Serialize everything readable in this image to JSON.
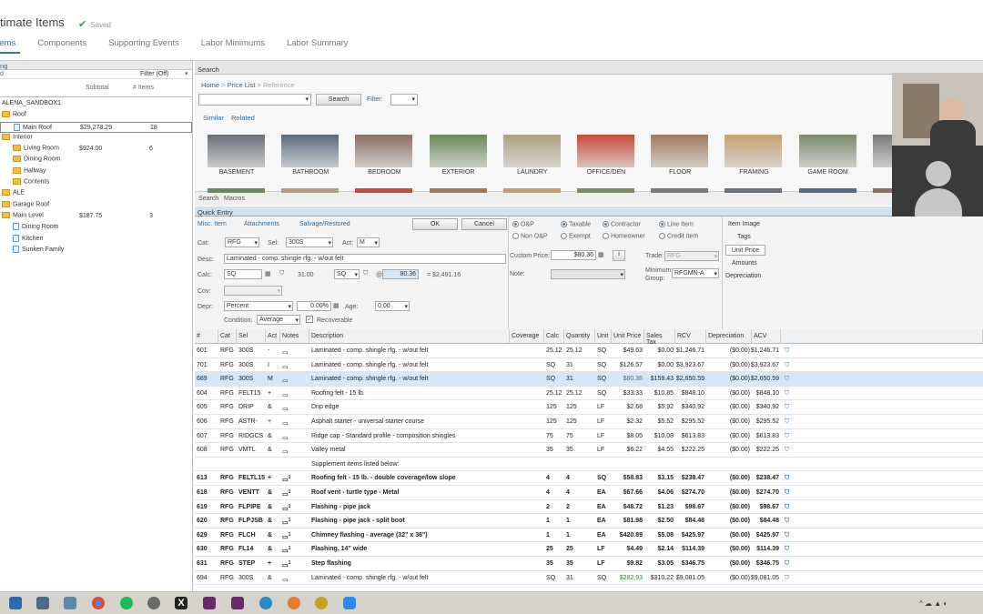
{
  "header": {
    "title": "timate Items",
    "saved": "Saved"
  },
  "tabs": [
    "Items",
    "Components",
    "Supporting Events",
    "Labor Minimums",
    "Labor Summary"
  ],
  "left": {
    "col_label": "ng",
    "filter": "Filter (Off)",
    "sub_label": "d",
    "subtotal_h": "Subtotal",
    "items_h": "# Items",
    "tree": [
      {
        "label": "ALENA_SANDBOX1",
        "type": "none",
        "indent": 0,
        "subtotal": "",
        "items": ""
      },
      {
        "label": "Roof",
        "type": "folder",
        "indent": 0,
        "subtotal": "",
        "items": ""
      },
      {
        "label": "Main Roof",
        "type": "page",
        "indent": 1,
        "subtotal": "$29,278.29",
        "items": "18"
      },
      {
        "label": "Interior",
        "type": "folder",
        "indent": 0,
        "subtotal": "",
        "items": ""
      },
      {
        "label": "Living Room",
        "type": "folder",
        "indent": 1,
        "subtotal": "$924.00",
        "items": "6"
      },
      {
        "label": "Dining Room",
        "type": "folder",
        "indent": 1,
        "subtotal": "",
        "items": ""
      },
      {
        "label": "Hallway",
        "type": "folder",
        "indent": 1,
        "subtotal": "",
        "items": ""
      },
      {
        "label": "Contents",
        "type": "folder",
        "indent": 1,
        "subtotal": "",
        "items": ""
      },
      {
        "label": "ALE",
        "type": "folder",
        "indent": 0,
        "subtotal": "",
        "items": ""
      },
      {
        "label": "Garage Roof",
        "type": "folder",
        "indent": 0,
        "subtotal": "",
        "items": ""
      },
      {
        "label": "Main Level",
        "type": "folder",
        "indent": 0,
        "subtotal": "$187.75",
        "items": "3"
      },
      {
        "label": "Dining Room",
        "type": "page",
        "indent": 1,
        "subtotal": "",
        "items": ""
      },
      {
        "label": "Kitchen",
        "type": "page",
        "indent": 1,
        "subtotal": "",
        "items": ""
      },
      {
        "label": "Sunken Family",
        "type": "page",
        "indent": 1,
        "subtotal": "",
        "items": ""
      }
    ]
  },
  "search": {
    "title": "Search",
    "crumbs": [
      "Home",
      ">",
      "Price List",
      ">",
      "Reference"
    ],
    "search_btn": "Search",
    "filter": "Filter:",
    "similar": "Similar",
    "related": "Related",
    "categories": [
      "BASEMENT",
      "BATHROOM",
      "BEDROOM",
      "EXTERIOR",
      "LAUNDRY",
      "OFFICE/DEN",
      "FLOOR",
      "FRAMING",
      "GAME ROOM",
      "G"
    ],
    "bottom_tabs": [
      "Search",
      "Macros"
    ]
  },
  "quick": {
    "title": "Quick Entry",
    "misc": "Misc. Item",
    "attach": "Attachments",
    "salvage": "Salvage/Restored",
    "ok": "OK",
    "cancel": "Cancel",
    "cat_l": "Cat:",
    "cat": "RFG",
    "sel_l": "Sel:",
    "sel": "300S",
    "act_l": "Act:",
    "act": "M",
    "desc_l": "Desc:",
    "desc": "Laminated - comp. shingle rfg. - w/out felt",
    "calc_l": "Calc:",
    "calc": "SQ",
    "qty": "31.00",
    "unit": "SQ",
    "at": "@",
    "price": "80.36",
    "total": "= $2,491.16",
    "cov_l": "Cov:",
    "depr_l": "Depr:",
    "depr": "Percent",
    "pct": "0.00%",
    "age_l": "Age:",
    "age": "0.00",
    "cond_l": "Condition:",
    "cond": "Average",
    "recov": "Recoverable",
    "op": "O&P",
    "nonop": "Non O&P",
    "taxable": "Taxable",
    "exempt": "Exempt",
    "contractor": "Contractor",
    "homeowner": "Homeowner",
    "lineitem": "Line Item",
    "credit": "Credit Item",
    "custom_l": "Custom Price:",
    "custom": "$80.36",
    "note_l": "Note:",
    "trade_l": "Trade:",
    "trade": "RFG",
    "min_l": "Minimum Group:",
    "min": "RFGMN-A",
    "side": [
      "Item Image",
      "Tags",
      "Unit Price",
      "Amounts",
      "Depreciation"
    ]
  },
  "table": {
    "headers": [
      "#",
      "Cat",
      "Sel",
      "Act",
      "Notes",
      "Description",
      "Coverage",
      "Calc",
      "Quantity",
      "Unit",
      "Unit Price",
      "Sales Tax",
      "RCV",
      "Depreciation",
      "ACV"
    ],
    "rows": [
      [
        "601",
        "RFG",
        "300S",
        "-",
        "",
        "Laminated - comp. shingle rfg. - w/out felt",
        "",
        "25.12",
        "25.12",
        "SQ",
        "$49.63",
        "$0.00",
        "$1,246.71",
        "($0.00)",
        "$1,246.71"
      ],
      [
        "701",
        "RFG",
        "300S",
        "I",
        "",
        "Laminated - comp. shingle rfg. - w/out felt",
        "",
        "SQ",
        "31",
        "SQ",
        "$126.57",
        "$0.00",
        "$3,923.67",
        "($0.00)",
        "$3,923.67"
      ],
      [
        "689",
        "RFG",
        "300S",
        "M",
        "",
        "Laminated - comp. shingle rfg. - w/out felt",
        "",
        "SQ",
        "31",
        "SQ",
        "$80.36",
        "$159.43",
        "$2,650.59",
        "($0.00)",
        "$2,650.59"
      ],
      [
        "604",
        "RFG",
        "FELT15",
        "+",
        "",
        "Roofing felt - 15 lb.",
        "",
        "25.12",
        "25.12",
        "SQ",
        "$33.33",
        "$10.85",
        "$848.10",
        "($0.00)",
        "$848.10"
      ],
      [
        "605",
        "RFG",
        "DRIP",
        "&",
        "",
        "Drip edge",
        "",
        "125",
        "125",
        "LF",
        "$2.68",
        "$5.92",
        "$340.92",
        "($0.00)",
        "$340.92"
      ],
      [
        "606",
        "RFG",
        "ASTR-",
        "+",
        "",
        "Asphalt starter - universal starter course",
        "",
        "125",
        "125",
        "LF",
        "$2.32",
        "$5.52",
        "$295.52",
        "($0.00)",
        "$295.52"
      ],
      [
        "607",
        "RFG",
        "RIDGCS",
        "&",
        "",
        "Ridge cap - Standard profile - composition shingles",
        "",
        "75",
        "75",
        "LF",
        "$8.05",
        "$10.08",
        "$613.83",
        "($0.00)",
        "$613.83"
      ],
      [
        "608",
        "RFG",
        "VMTL",
        "&",
        "",
        "Valley metal",
        "",
        "35",
        "35",
        "LF",
        "$6.22",
        "$4.55",
        "$222.25",
        "($0.00)",
        "$222.25"
      ],
      [
        "",
        "",
        "",
        "",
        "",
        "Supplement items listed below:",
        "",
        "",
        "",
        "",
        "",
        "",
        "",
        "",
        ""
      ],
      [
        "613",
        "RFG",
        "FELTL15",
        "+",
        "1",
        "Roofing felt - 15 lb. - double coverage/low slope",
        "",
        "4",
        "4",
        "SQ",
        "$58.83",
        "$3.15",
        "$238.47",
        "($0.00)",
        "$238.47"
      ],
      [
        "618",
        "RFG",
        "VENTT",
        "&",
        "1",
        "Roof vent - turtle type - Metal",
        "",
        "4",
        "4",
        "EA",
        "$67.66",
        "$4.06",
        "$274.70",
        "($0.00)",
        "$274.70"
      ],
      [
        "619",
        "RFG",
        "FLPIPE",
        "&",
        "1",
        "Flashing - pipe jack",
        "",
        "2",
        "2",
        "EA",
        "$48.72",
        "$1.23",
        "$98.67",
        "($0.00)",
        "$98.67"
      ],
      [
        "620",
        "RFG",
        "FLPJSB",
        "&",
        "1",
        "Flashing - pipe jack - split boot",
        "",
        "1",
        "1",
        "EA",
        "$81.98",
        "$2.50",
        "$84.48",
        "($0.00)",
        "$84.48"
      ],
      [
        "629",
        "RFG",
        "FLCH",
        "&",
        "1",
        "Chimney flashing - average (32\" x 36\")",
        "",
        "1",
        "1",
        "EA",
        "$420.89",
        "$5.08",
        "$425.97",
        "($0.00)",
        "$425.97"
      ],
      [
        "630",
        "RFG",
        "FL14",
        "&",
        "1",
        "Flashing, 14\" wide",
        "",
        "25",
        "25",
        "LF",
        "$4.49",
        "$2.14",
        "$114.39",
        "($0.00)",
        "$114.39"
      ],
      [
        "631",
        "RFG",
        "STEP",
        "+",
        "1",
        "Step flashing",
        "",
        "35",
        "35",
        "LF",
        "$9.82",
        "$3.05",
        "$346.75",
        "($0.00)",
        "$346.75"
      ],
      [
        "694",
        "RFG",
        "300S",
        "&",
        "",
        "Laminated - comp. shingle rfg. - w/out felt",
        "",
        "SQ",
        "31",
        "SQ",
        "$282.93",
        "$310.22",
        "$9,081.05",
        "($0.00)",
        "$9,081.05"
      ]
    ]
  },
  "colors": {
    "accent": "#2a7ab0",
    "highlight": "#d5e8f8",
    "green": "#2a8a3a"
  }
}
